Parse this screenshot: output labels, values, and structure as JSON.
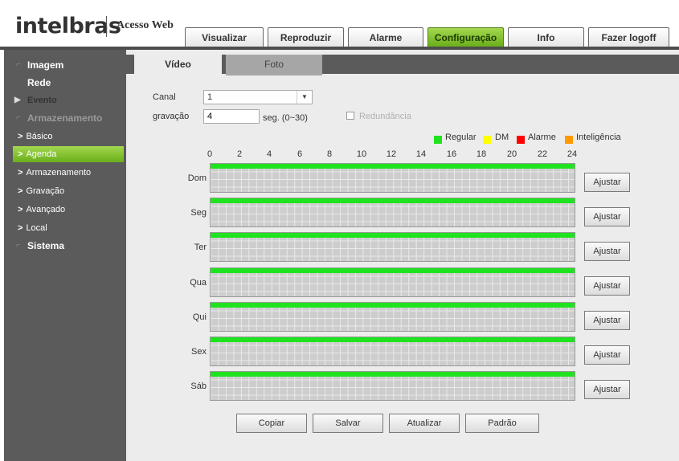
{
  "header": {
    "logo": "intelbras",
    "subtitle": "Acesso Web",
    "tabs": [
      "Visualizar",
      "Reproduzir",
      "Alarme",
      "Configuração",
      "Info",
      "Fazer logoff"
    ],
    "active_tab": "Configuração"
  },
  "sidebar": {
    "items": [
      {
        "label": "Imagem",
        "level": "main"
      },
      {
        "label": "Rede",
        "level": "main"
      },
      {
        "label": "Evento",
        "level": "main"
      },
      {
        "label": "Armazenamento",
        "level": "main"
      },
      {
        "label": "Básico",
        "level": "sub"
      },
      {
        "label": "Agenda",
        "level": "sub",
        "selected": true
      },
      {
        "label": "Armazenamento",
        "level": "sub"
      },
      {
        "label": "Gravação",
        "level": "sub"
      },
      {
        "label": "Avançado",
        "level": "sub"
      },
      {
        "label": "Local",
        "level": "sub"
      },
      {
        "label": "Sistema",
        "level": "main"
      }
    ]
  },
  "subtabs": [
    "Vídeo",
    "Foto"
  ],
  "form": {
    "canal_label": "Canal",
    "canal_value": "1",
    "gravacao_label": "gravação",
    "gravacao_value": "4",
    "gravacao_unit": "seg. (0~30)",
    "redundancia_label": "Redundância"
  },
  "legend": [
    {
      "label": "Regular",
      "color": "#1ee31e"
    },
    {
      "label": "DM",
      "color": "#ffff00"
    },
    {
      "label": "Alarme",
      "color": "#ff0000"
    },
    {
      "label": "Inteligência",
      "color": "#ff9900"
    }
  ],
  "hours": [
    "0",
    "2",
    "4",
    "6",
    "8",
    "10",
    "12",
    "14",
    "16",
    "18",
    "20",
    "22",
    "24"
  ],
  "days": [
    "Dom",
    "Seg",
    "Ter",
    "Qua",
    "Qui",
    "Sex",
    "Sáb"
  ],
  "adjust_label": "Ajustar",
  "buttons": {
    "copy": "Copiar",
    "save": "Salvar",
    "refresh": "Atualizar",
    "default": "Padrão"
  },
  "colors": {
    "accent": "#7cc02a",
    "sidebar": "#5b5b5b",
    "schedule_regular": "#1ee31e"
  }
}
